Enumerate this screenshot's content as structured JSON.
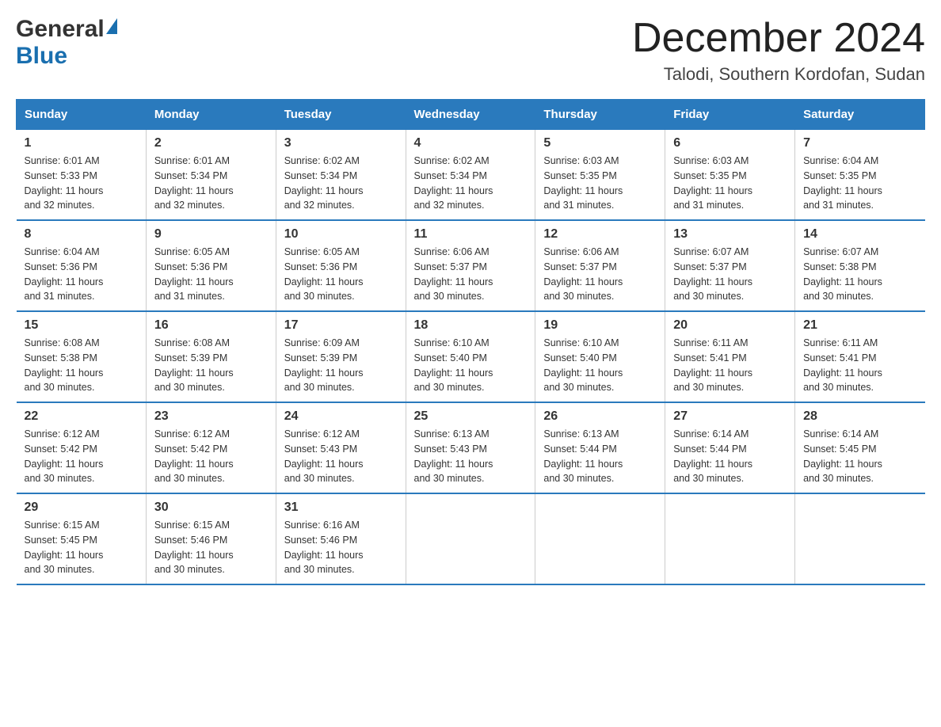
{
  "header": {
    "logo_general": "General",
    "logo_blue": "Blue",
    "title": "December 2024",
    "subtitle": "Talodi, Southern Kordofan, Sudan"
  },
  "weekdays": [
    "Sunday",
    "Monday",
    "Tuesday",
    "Wednesday",
    "Thursday",
    "Friday",
    "Saturday"
  ],
  "weeks": [
    [
      {
        "day": "1",
        "sunrise": "6:01 AM",
        "sunset": "5:33 PM",
        "daylight": "11 hours and 32 minutes."
      },
      {
        "day": "2",
        "sunrise": "6:01 AM",
        "sunset": "5:34 PM",
        "daylight": "11 hours and 32 minutes."
      },
      {
        "day": "3",
        "sunrise": "6:02 AM",
        "sunset": "5:34 PM",
        "daylight": "11 hours and 32 minutes."
      },
      {
        "day": "4",
        "sunrise": "6:02 AM",
        "sunset": "5:34 PM",
        "daylight": "11 hours and 32 minutes."
      },
      {
        "day": "5",
        "sunrise": "6:03 AM",
        "sunset": "5:35 PM",
        "daylight": "11 hours and 31 minutes."
      },
      {
        "day": "6",
        "sunrise": "6:03 AM",
        "sunset": "5:35 PM",
        "daylight": "11 hours and 31 minutes."
      },
      {
        "day": "7",
        "sunrise": "6:04 AM",
        "sunset": "5:35 PM",
        "daylight": "11 hours and 31 minutes."
      }
    ],
    [
      {
        "day": "8",
        "sunrise": "6:04 AM",
        "sunset": "5:36 PM",
        "daylight": "11 hours and 31 minutes."
      },
      {
        "day": "9",
        "sunrise": "6:05 AM",
        "sunset": "5:36 PM",
        "daylight": "11 hours and 31 minutes."
      },
      {
        "day": "10",
        "sunrise": "6:05 AM",
        "sunset": "5:36 PM",
        "daylight": "11 hours and 30 minutes."
      },
      {
        "day": "11",
        "sunrise": "6:06 AM",
        "sunset": "5:37 PM",
        "daylight": "11 hours and 30 minutes."
      },
      {
        "day": "12",
        "sunrise": "6:06 AM",
        "sunset": "5:37 PM",
        "daylight": "11 hours and 30 minutes."
      },
      {
        "day": "13",
        "sunrise": "6:07 AM",
        "sunset": "5:37 PM",
        "daylight": "11 hours and 30 minutes."
      },
      {
        "day": "14",
        "sunrise": "6:07 AM",
        "sunset": "5:38 PM",
        "daylight": "11 hours and 30 minutes."
      }
    ],
    [
      {
        "day": "15",
        "sunrise": "6:08 AM",
        "sunset": "5:38 PM",
        "daylight": "11 hours and 30 minutes."
      },
      {
        "day": "16",
        "sunrise": "6:08 AM",
        "sunset": "5:39 PM",
        "daylight": "11 hours and 30 minutes."
      },
      {
        "day": "17",
        "sunrise": "6:09 AM",
        "sunset": "5:39 PM",
        "daylight": "11 hours and 30 minutes."
      },
      {
        "day": "18",
        "sunrise": "6:10 AM",
        "sunset": "5:40 PM",
        "daylight": "11 hours and 30 minutes."
      },
      {
        "day": "19",
        "sunrise": "6:10 AM",
        "sunset": "5:40 PM",
        "daylight": "11 hours and 30 minutes."
      },
      {
        "day": "20",
        "sunrise": "6:11 AM",
        "sunset": "5:41 PM",
        "daylight": "11 hours and 30 minutes."
      },
      {
        "day": "21",
        "sunrise": "6:11 AM",
        "sunset": "5:41 PM",
        "daylight": "11 hours and 30 minutes."
      }
    ],
    [
      {
        "day": "22",
        "sunrise": "6:12 AM",
        "sunset": "5:42 PM",
        "daylight": "11 hours and 30 minutes."
      },
      {
        "day": "23",
        "sunrise": "6:12 AM",
        "sunset": "5:42 PM",
        "daylight": "11 hours and 30 minutes."
      },
      {
        "day": "24",
        "sunrise": "6:12 AM",
        "sunset": "5:43 PM",
        "daylight": "11 hours and 30 minutes."
      },
      {
        "day": "25",
        "sunrise": "6:13 AM",
        "sunset": "5:43 PM",
        "daylight": "11 hours and 30 minutes."
      },
      {
        "day": "26",
        "sunrise": "6:13 AM",
        "sunset": "5:44 PM",
        "daylight": "11 hours and 30 minutes."
      },
      {
        "day": "27",
        "sunrise": "6:14 AM",
        "sunset": "5:44 PM",
        "daylight": "11 hours and 30 minutes."
      },
      {
        "day": "28",
        "sunrise": "6:14 AM",
        "sunset": "5:45 PM",
        "daylight": "11 hours and 30 minutes."
      }
    ],
    [
      {
        "day": "29",
        "sunrise": "6:15 AM",
        "sunset": "5:45 PM",
        "daylight": "11 hours and 30 minutes."
      },
      {
        "day": "30",
        "sunrise": "6:15 AM",
        "sunset": "5:46 PM",
        "daylight": "11 hours and 30 minutes."
      },
      {
        "day": "31",
        "sunrise": "6:16 AM",
        "sunset": "5:46 PM",
        "daylight": "11 hours and 30 minutes."
      },
      null,
      null,
      null,
      null
    ]
  ],
  "labels": {
    "sunrise": "Sunrise: ",
    "sunset": "Sunset: ",
    "daylight": "Daylight: "
  }
}
